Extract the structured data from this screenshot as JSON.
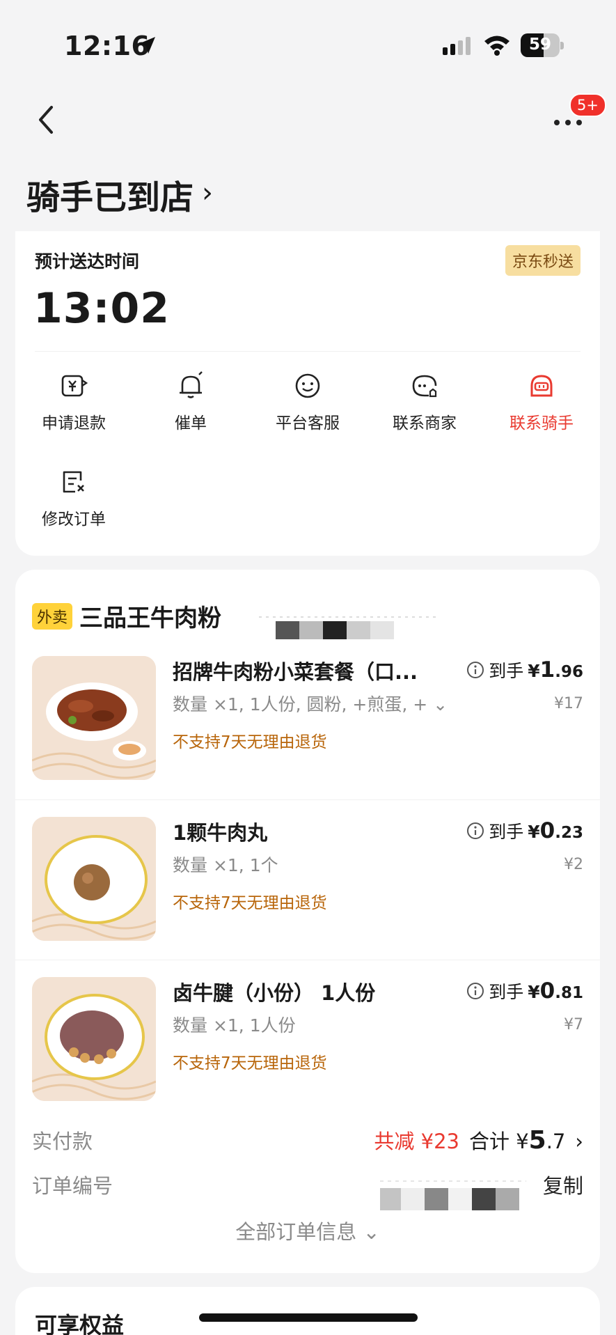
{
  "status_bar": {
    "time": "12:16",
    "battery": "59",
    "battery_level": 0.59
  },
  "header": {
    "title": "骑手已到店",
    "badge": "5+"
  },
  "delivery": {
    "eta_label": "预计送达时间",
    "eta_time": "13:02",
    "service_tag": "京东秒送",
    "actions": [
      {
        "label": "申请退款",
        "icon": "refund-icon"
      },
      {
        "label": "催单",
        "icon": "bell-icon"
      },
      {
        "label": "平台客服",
        "icon": "service-icon"
      },
      {
        "label": "联系商家",
        "icon": "merchant-chat-icon"
      },
      {
        "label": "联系骑手",
        "icon": "rider-icon",
        "highlight": true
      },
      {
        "label": "修改订单",
        "icon": "edit-order-icon"
      }
    ],
    "accent_color": "#e93a30"
  },
  "order": {
    "store_tag": "外卖",
    "store_name": "三品王牛肉粉",
    "items": [
      {
        "name": "招牌牛肉粉小菜套餐（口...",
        "spec": "数量 ×1, 1人份, 圆粉, +煎蛋, +",
        "note": "不支持7天无理由退货",
        "label": "到手",
        "yen": "¥",
        "price_int": "1",
        "price_dec": ".96",
        "orig_price": "¥17"
      },
      {
        "name": "1颗牛肉丸",
        "spec": "数量 ×1, 1个",
        "note": "不支持7天无理由退货",
        "label": "到手",
        "yen": "¥",
        "price_int": "0",
        "price_dec": ".23",
        "orig_price": "¥2"
      },
      {
        "name": "卤牛腱（小份） 1人份",
        "spec": "数量 ×1, 1人份",
        "note": "不支持7天无理由退货",
        "label": "到手",
        "yen": "¥",
        "price_int": "0",
        "price_dec": ".81",
        "orig_price": "¥7"
      }
    ],
    "paid_label": "实付款",
    "discount": "共减 ¥23",
    "total_label": "合计 ¥",
    "total_int": "5",
    "total_dec": ".7",
    "order_no_label": "订单编号",
    "copy_label": "复制",
    "all_info": "全部订单信息"
  },
  "benefits": {
    "title": "可享权益"
  }
}
